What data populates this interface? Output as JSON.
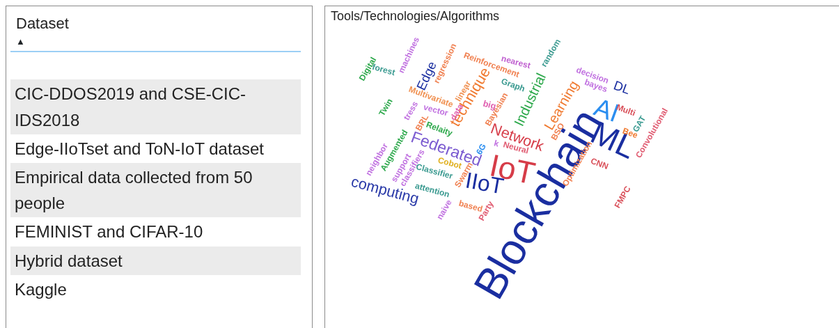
{
  "slicer": {
    "title": "Dataset",
    "sort_indicator": "▲",
    "items": [
      "CIC-DDOS2019 and CSE-CIC-IDS2018",
      "Edge-IIoTset and ToN-IoT dataset",
      "Empirical data collected from 50 people",
      "FEMINIST and CIFAR-10",
      "Hybrid dataset",
      "Kaggle"
    ]
  },
  "word_cloud": {
    "title": "Tools/Technologies/Algorithms",
    "words": [
      {
        "text": "Blockchain",
        "color": "#1a2ea0"
      },
      {
        "text": "IoT",
        "color": "#d63c48"
      },
      {
        "text": "ML",
        "color": "#1a2ea0"
      },
      {
        "text": "AI",
        "color": "#2b8ef0"
      },
      {
        "text": "IIoT",
        "color": "#1a2ea0"
      },
      {
        "text": "computing",
        "color": "#2a3aa8"
      },
      {
        "text": "Federated",
        "color": "#7a5ad0"
      },
      {
        "text": "Network",
        "color": "#d63c48"
      },
      {
        "text": "technique",
        "color": "#f07a30"
      },
      {
        "text": "Industrial",
        "color": "#2ba84a"
      },
      {
        "text": "Learning",
        "color": "#f07a30"
      },
      {
        "text": "Edge",
        "color": "#1a2ea0"
      },
      {
        "text": "DL",
        "color": "#1a2ea0"
      },
      {
        "text": "Reinforcement",
        "color": "#f08050"
      },
      {
        "text": "nearest",
        "color": "#c060d0"
      },
      {
        "text": "random",
        "color": "#3a9a90"
      },
      {
        "text": "decision",
        "color": "#c070e0"
      },
      {
        "text": "bayes",
        "color": "#c070e0"
      },
      {
        "text": "Graph",
        "color": "#3a9a90"
      },
      {
        "text": "Multi",
        "color": "#d9505a"
      },
      {
        "text": "GAT",
        "color": "#3a9a90"
      },
      {
        "text": "Bee",
        "color": "#f07a30"
      },
      {
        "text": "Convolutional",
        "color": "#e05a70"
      },
      {
        "text": "BSO",
        "color": "#f08050"
      },
      {
        "text": "Neural",
        "color": "#e05a70"
      },
      {
        "text": "k",
        "color": "#c070e0"
      },
      {
        "text": "CNN",
        "color": "#d9505a"
      },
      {
        "text": "Optimization",
        "color": "#f08050"
      },
      {
        "text": "FMPC",
        "color": "#d9505a"
      },
      {
        "text": "Bayesian",
        "color": "#f08050"
      },
      {
        "text": "big",
        "color": "#e060b0"
      },
      {
        "text": "Digital",
        "color": "#2ba84a"
      },
      {
        "text": "forest",
        "color": "#3a9a90"
      },
      {
        "text": "machines",
        "color": "#c070e0"
      },
      {
        "text": "regression",
        "color": "#f08050"
      },
      {
        "text": "Multivariate",
        "color": "#f09050"
      },
      {
        "text": "linear",
        "color": "#f09050"
      },
      {
        "text": "Twin",
        "color": "#2ba84a"
      },
      {
        "text": "tress",
        "color": "#c070e0"
      },
      {
        "text": "vector",
        "color": "#c070e0"
      },
      {
        "text": "data",
        "color": "#e060b0"
      },
      {
        "text": "BRL",
        "color": "#f08050"
      },
      {
        "text": "Relaity",
        "color": "#2ba84a"
      },
      {
        "text": "6G",
        "color": "#2b8ef0"
      },
      {
        "text": "neighbor",
        "color": "#c070e0"
      },
      {
        "text": "Augmented",
        "color": "#2ba84a"
      },
      {
        "text": "support",
        "color": "#c070e0"
      },
      {
        "text": "classifiers",
        "color": "#c070e0"
      },
      {
        "text": "Cobot",
        "color": "#e0b020"
      },
      {
        "text": "Classifier",
        "color": "#3a9a90"
      },
      {
        "text": "Swarm",
        "color": "#f08050"
      },
      {
        "text": "attention",
        "color": "#3a9a90"
      },
      {
        "text": "naive",
        "color": "#c070e0"
      },
      {
        "text": "based",
        "color": "#f08050"
      },
      {
        "text": "Party",
        "color": "#e05a70"
      }
    ]
  }
}
